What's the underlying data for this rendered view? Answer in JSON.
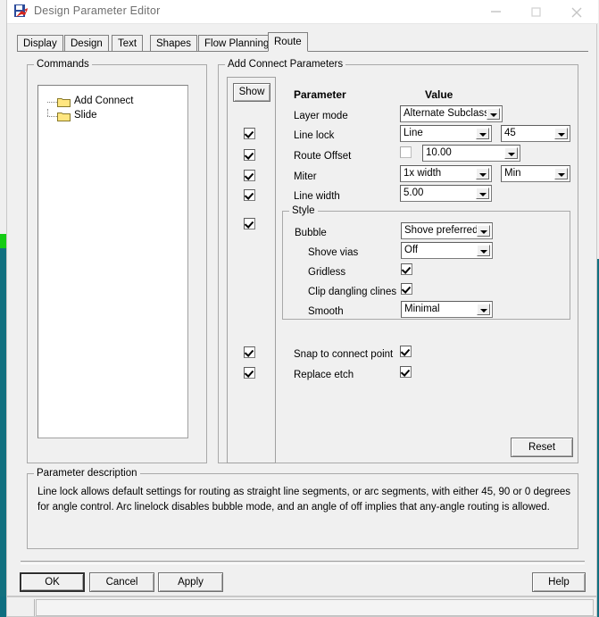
{
  "window": {
    "title": "Design Parameter Editor",
    "icon": "allegro-app-icon",
    "controls": {
      "minimize": "minimize-icon",
      "maximize": "maximize-icon",
      "close": "close-icon"
    }
  },
  "tabs": [
    {
      "label": "Display",
      "selected": false
    },
    {
      "label": "Design",
      "selected": false
    },
    {
      "label": "Text",
      "selected": false
    },
    {
      "label": "Shapes",
      "selected": false
    },
    {
      "label": "Flow Planning",
      "selected": false
    },
    {
      "label": "Route",
      "selected": true
    }
  ],
  "commands": {
    "legend": "Commands",
    "items": [
      {
        "label": "Add Connect",
        "icon": "folder-icon"
      },
      {
        "label": "Slide",
        "icon": "folder-icon"
      }
    ]
  },
  "parameters": {
    "legend": "Add Connect Parameters",
    "show_button": "Show",
    "headers": {
      "parameter": "Parameter",
      "value": "Value"
    },
    "rows": [
      {
        "label": "Layer mode",
        "show_checked": null,
        "control": "combo",
        "value": "Alternate Subclass"
      },
      {
        "label": "Line lock",
        "show_checked": true,
        "control": "combo2",
        "value": "Line",
        "value2": "45"
      },
      {
        "label": "Route Offset",
        "show_checked": true,
        "control": "checkbox-combo",
        "enabled": false,
        "value": "10.00"
      },
      {
        "label": "Miter",
        "show_checked": true,
        "control": "combo2",
        "value": "1x width",
        "value2": "Min"
      },
      {
        "label": "Line width",
        "show_checked": true,
        "control": "combo",
        "value": "5.00"
      }
    ],
    "style": {
      "legend": "Style",
      "show_checked": true,
      "rows": [
        {
          "label": "Bubble",
          "control": "combo",
          "value": "Shove preferred",
          "indent": 0
        },
        {
          "label": "Shove vias",
          "control": "combo",
          "value": "Off",
          "indent": 1
        },
        {
          "label": "Gridless",
          "control": "checkbox",
          "checked": true,
          "indent": 1
        },
        {
          "label": "Clip dangling clines",
          "control": "checkbox",
          "checked": true,
          "indent": 1
        },
        {
          "label": "Smooth",
          "control": "combo",
          "value": "Minimal",
          "indent": 1
        }
      ]
    },
    "bottom_rows": [
      {
        "label": "Snap to connect point",
        "show_checked": true,
        "control": "checkbox",
        "checked": true
      },
      {
        "label": "Replace etch",
        "show_checked": true,
        "control": "checkbox",
        "checked": true
      }
    ],
    "reset_button": "Reset"
  },
  "description": {
    "legend": "Parameter description",
    "text": "Line lock allows default settings for routing as straight line segments, or arc segments, with either 45, 90 or 0 degrees for angle control.  Arc linelock disables bubble mode, and an angle of off implies that any-angle routing is allowed."
  },
  "footer": {
    "ok": "OK",
    "cancel": "Cancel",
    "apply": "Apply",
    "help": "Help"
  },
  "colors": {
    "desktop": "#0e6e80",
    "accent_green": "#14cc14",
    "dialog_face": "#f0f0f0",
    "folder": "#ffe680"
  }
}
